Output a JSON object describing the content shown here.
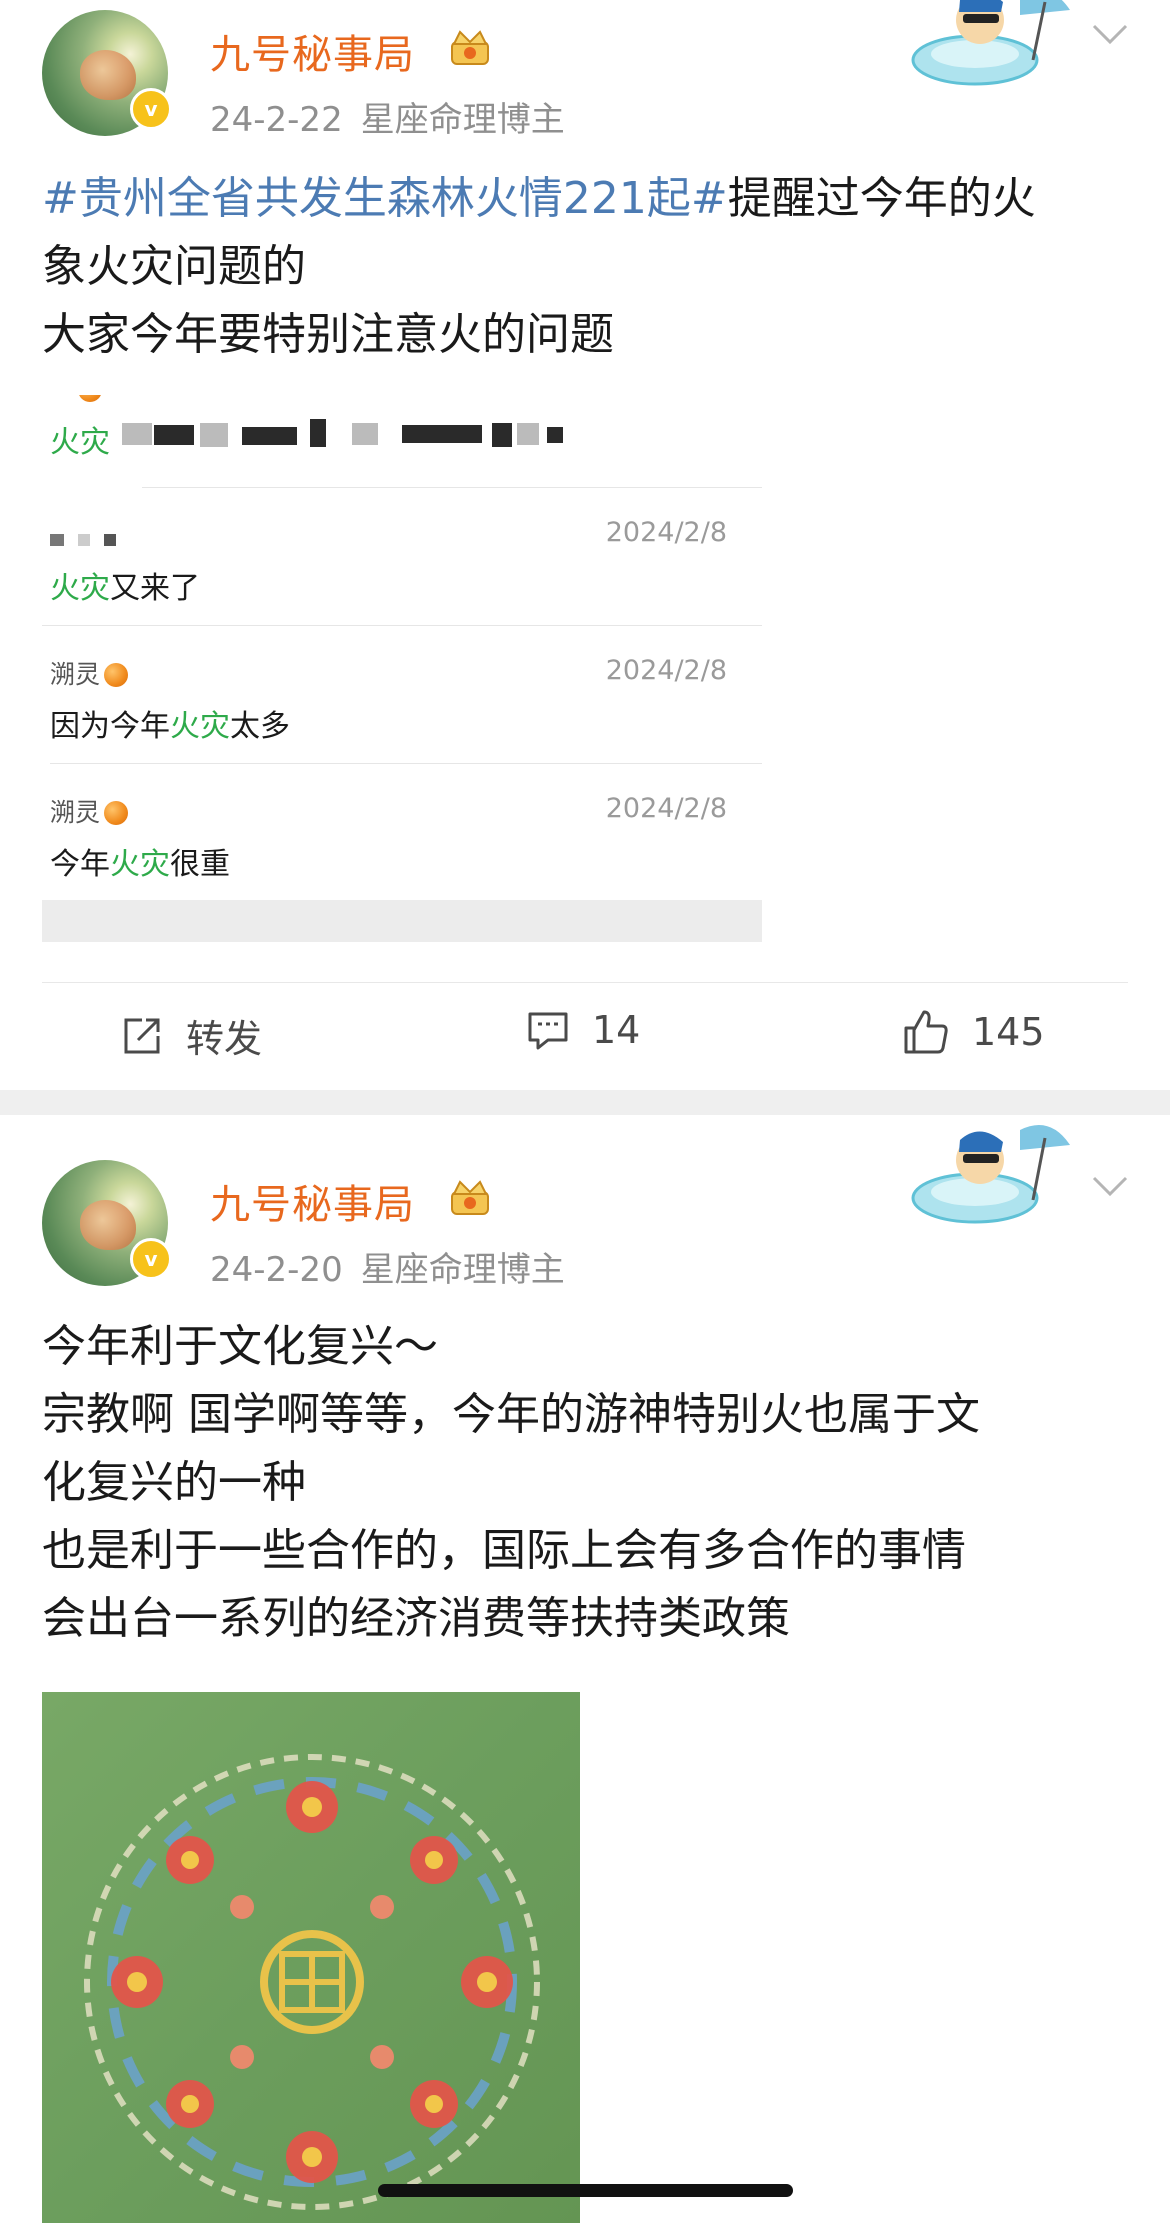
{
  "posts": [
    {
      "username": "九号秘事局",
      "date": "24-2-22",
      "source": "星座命理博主",
      "hashtag": "#贵州全省共发生森林火情221起#",
      "text_after_hashtag": "提醒过今年的火",
      "lines": [
        "象火灾问题的",
        "大家今年要特别注意火的问题"
      ],
      "embedded_comments": [
        {
          "name": "溯灵",
          "date": "2024/2/8",
          "keyword": "火灾",
          "rest": "又来了"
        },
        {
          "name": "溯灵",
          "date": "2024/2/8",
          "prefix": "因为今年",
          "keyword": "火灾",
          "rest": "太多"
        },
        {
          "name": "溯灵",
          "date": "2024/2/8",
          "prefix": "今年",
          "keyword": "火灾",
          "rest": "很重"
        }
      ],
      "partial_top_keyword": "火灾",
      "actions": {
        "repost": "转发",
        "comments": "14",
        "likes": "145"
      }
    },
    {
      "username": "九号秘事局",
      "date": "24-2-20",
      "source": "星座命理博主",
      "lines": [
        "今年利于文化复兴～",
        "宗教啊 国学啊等等，今年的游神特别火也属于文",
        "化复兴的一种",
        "也是利于一些合作的，国际上会有多合作的事情",
        "会出台一系列的经济消费等扶持类政策"
      ]
    }
  ],
  "icons": [
    "verified-badge-icon",
    "crown-icon",
    "chevron-down-icon",
    "repost-icon",
    "comment-icon",
    "like-icon",
    "orange-emoji-icon"
  ],
  "colors": {
    "username": "#e8681e",
    "hashtag": "#4c7bb3",
    "keyword": "#2eaa4a",
    "meta": "#8f8f8f"
  }
}
